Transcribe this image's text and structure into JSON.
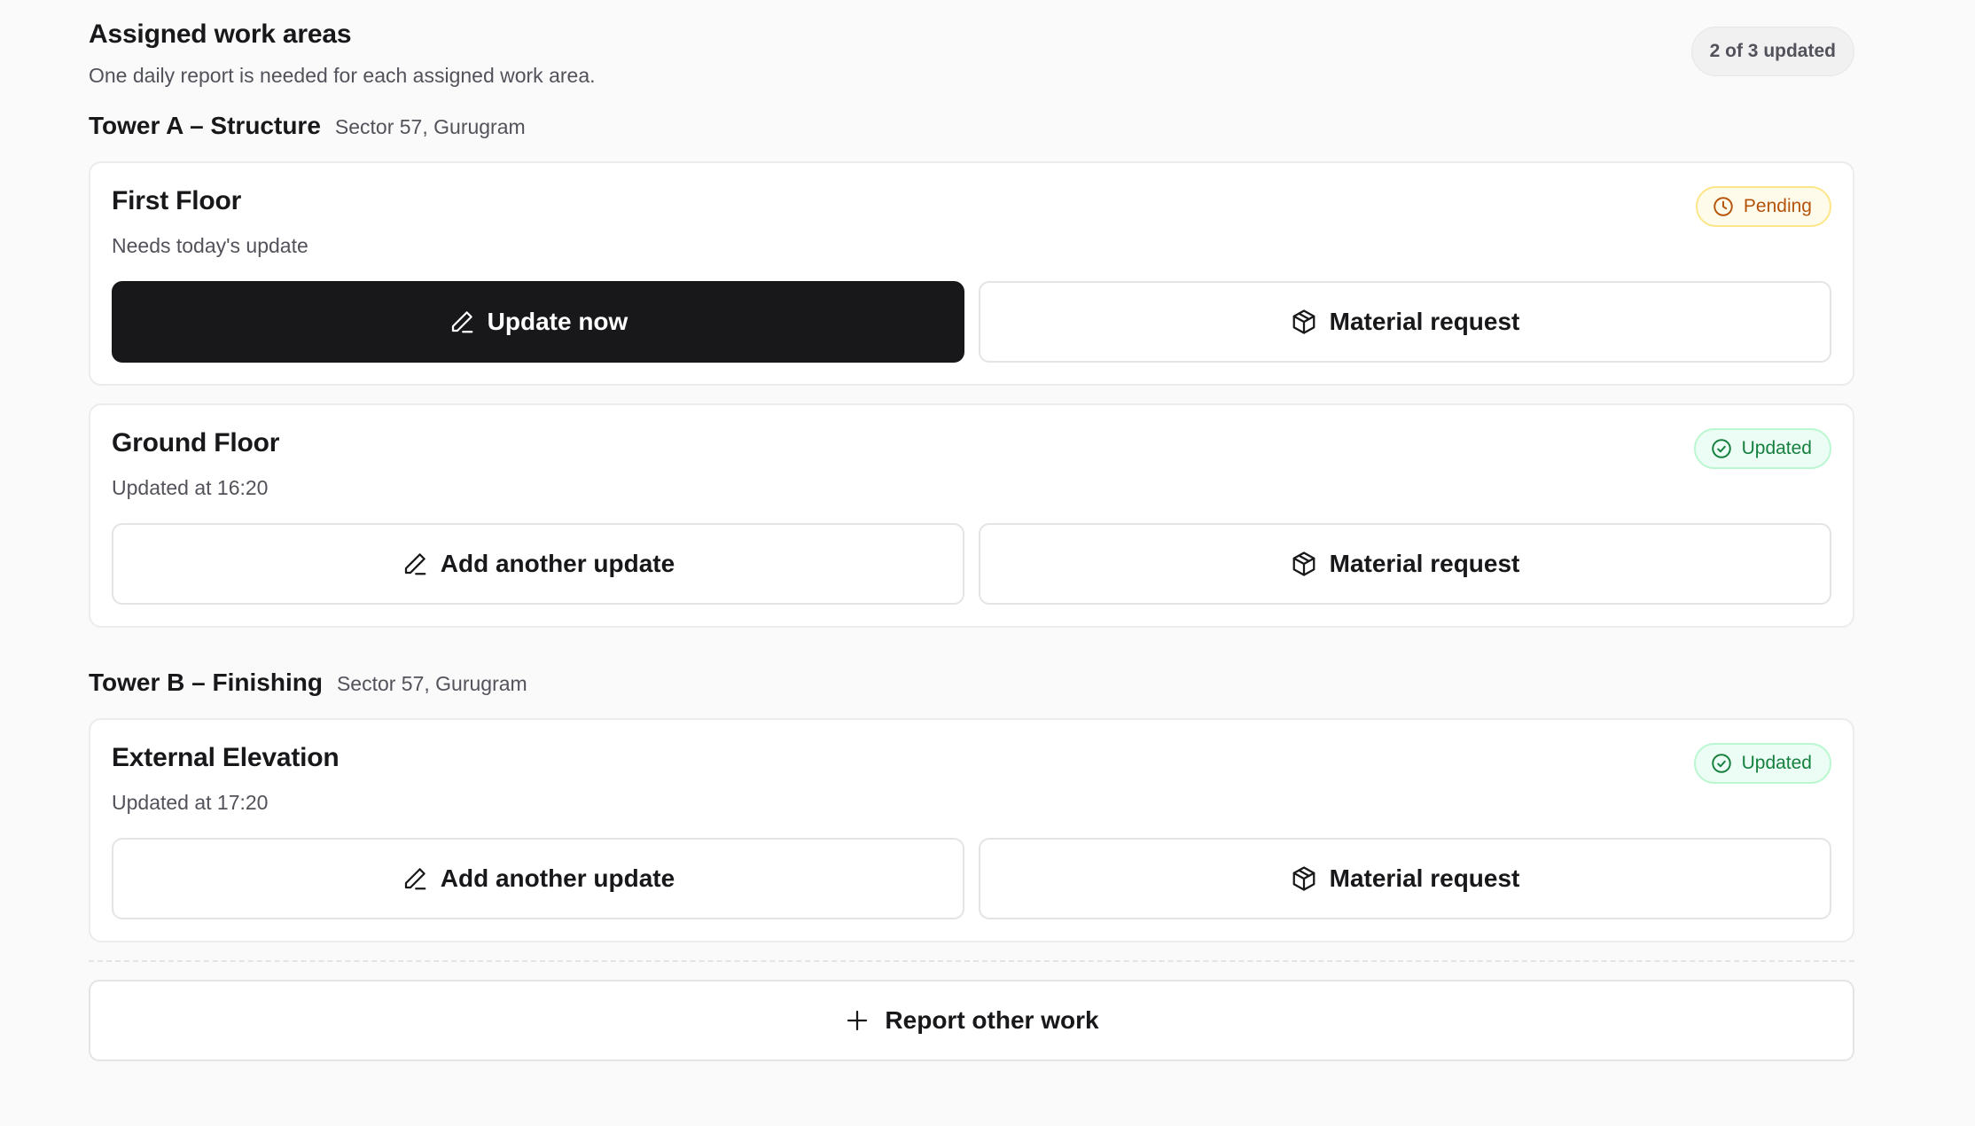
{
  "header": {
    "title": "Assigned work areas",
    "subtitle": "One daily report is needed for each assigned work area.",
    "progress": "2 of 3 updated"
  },
  "groups": [
    {
      "name": "Tower A – Structure",
      "location": "Sector 57, Gurugram",
      "areas": [
        {
          "title": "First Floor",
          "status": "Pending",
          "status_icon": "clock-icon",
          "meta": "Needs today's update",
          "primary_label": "Update now",
          "secondary_label": "Material request"
        },
        {
          "title": "Ground Floor",
          "status": "Updated",
          "status_icon": "check-circle-icon",
          "meta": "Updated at 16:20",
          "primary_label": "Add another update",
          "secondary_label": "Material request"
        }
      ]
    },
    {
      "name": "Tower B – Finishing",
      "location": "Sector 57, Gurugram",
      "areas": [
        {
          "title": "External Elevation",
          "status": "Updated",
          "status_icon": "check-circle-icon",
          "meta": "Updated at 17:20",
          "primary_label": "Add another update",
          "secondary_label": "Material request"
        }
      ]
    }
  ],
  "footer": {
    "report_label": "Report other work"
  },
  "colors": {
    "primary": "#18181b",
    "pending_text": "#b45309",
    "updated_text": "#15803d"
  }
}
